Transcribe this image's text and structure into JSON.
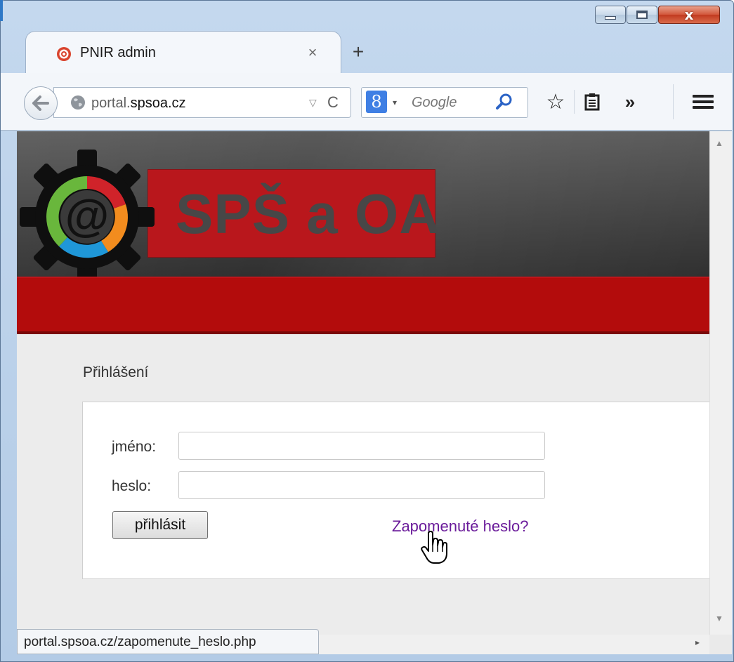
{
  "browser": {
    "tab": {
      "title": "PNIR admin",
      "close_glyph": "×"
    },
    "new_tab_glyph": "+",
    "url": {
      "prefix": "portal.",
      "domain": "spsoa.cz"
    },
    "search": {
      "engine_badge": "8",
      "placeholder": "Google"
    },
    "toolbar_glyphs": {
      "bookmark": "☆",
      "overflow": "»",
      "back": "←",
      "reload": "C"
    },
    "window_controls": {
      "close_glyph": "x"
    }
  },
  "page": {
    "logo_text": "SPŠ a OA",
    "login": {
      "title": "Přihlášení",
      "name_label": "jméno:",
      "password_label": "heslo:",
      "name_value": "",
      "password_value": "",
      "submit_label": "přihlásit",
      "forgot_link": "Zapomenuté heslo?"
    }
  },
  "status_bar": {
    "url": "portal.spsoa.cz/zapomenute_heslo.php"
  },
  "colors": {
    "brand_red": "#b30c0c",
    "link_visited": "#6a1b9a",
    "logo_box": "#b9171c"
  }
}
